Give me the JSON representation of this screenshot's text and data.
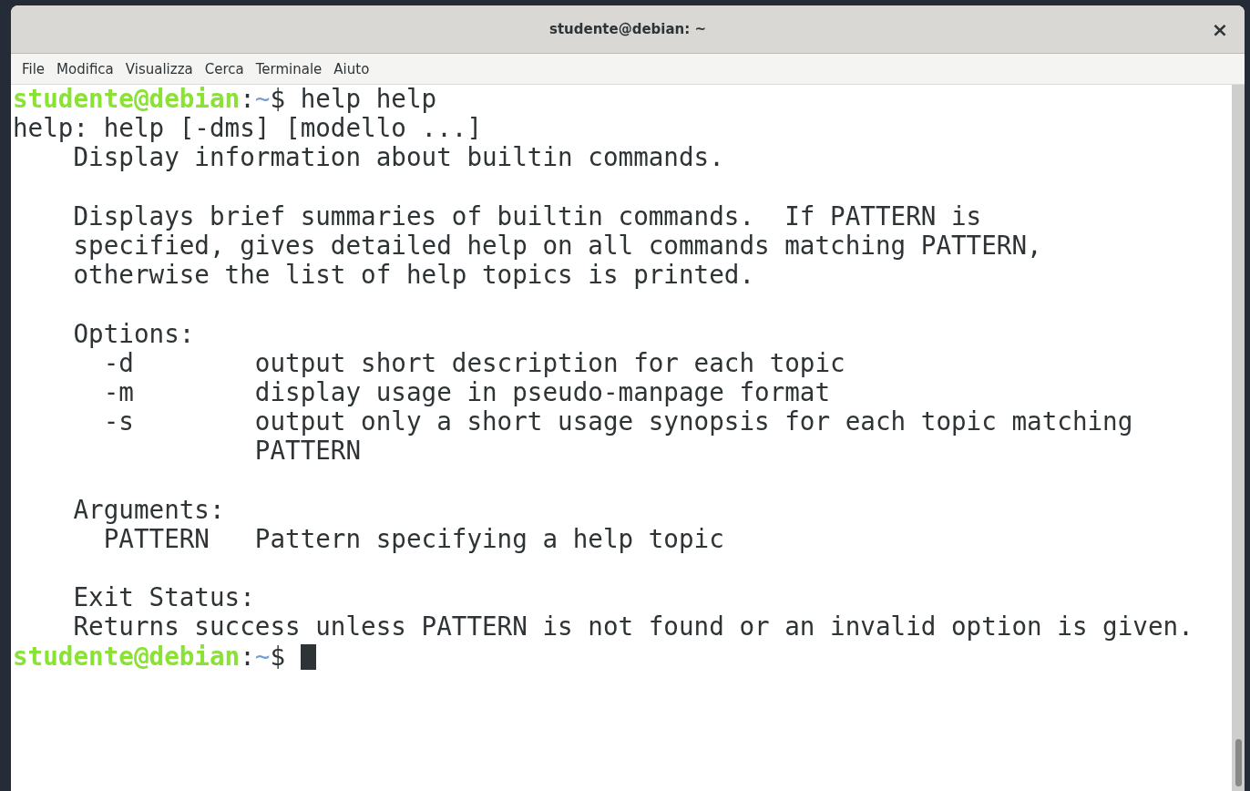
{
  "window": {
    "title": "studente@debian: ~",
    "close": "×"
  },
  "menu": [
    "File",
    "Modifica",
    "Visualizza",
    "Cerca",
    "Terminale",
    "Aiuto"
  ],
  "terminal": {
    "lines": [
      {
        "kind": "prompt",
        "user_host": "studente@debian",
        "separator": ":",
        "path": "~",
        "symbol": "$",
        "command": "help help"
      },
      {
        "kind": "output",
        "text": "help: help [-dms] [modello ...]"
      },
      {
        "kind": "output",
        "text": "    Display information about builtin commands."
      },
      {
        "kind": "blank"
      },
      {
        "kind": "output",
        "text": "    Displays brief summaries of builtin commands.  If PATTERN is"
      },
      {
        "kind": "output",
        "text": "    specified, gives detailed help on all commands matching PATTERN,"
      },
      {
        "kind": "output",
        "text": "    otherwise the list of help topics is printed."
      },
      {
        "kind": "blank"
      },
      {
        "kind": "output",
        "text": "    Options:"
      },
      {
        "kind": "output",
        "text": "      -d        output short description for each topic"
      },
      {
        "kind": "output",
        "text": "      -m        display usage in pseudo-manpage format"
      },
      {
        "kind": "output",
        "text": "      -s        output only a short usage synopsis for each topic matching"
      },
      {
        "kind": "output",
        "text": "                PATTERN"
      },
      {
        "kind": "blank"
      },
      {
        "kind": "output",
        "text": "    Arguments:"
      },
      {
        "kind": "output",
        "text": "      PATTERN   Pattern specifying a help topic"
      },
      {
        "kind": "blank"
      },
      {
        "kind": "output",
        "text": "    Exit Status:"
      },
      {
        "kind": "output",
        "text": "    Returns success unless PATTERN is not found or an invalid option is given."
      },
      {
        "kind": "prompt",
        "user_host": "studente@debian",
        "separator": ":",
        "path": "~",
        "symbol": "$",
        "cursor": true
      }
    ]
  }
}
